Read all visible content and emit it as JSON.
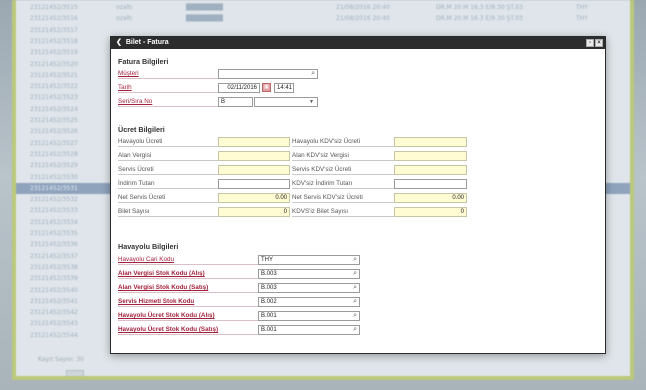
{
  "background": {
    "rows": [
      {
        "id": "23121452/3515",
        "c2": "ozaltı",
        "c3": "████████",
        "c4": "21/08/2016 20:40",
        "c5": "DR.M    20.M   16.3  E/9.30 ŞT.03",
        "c6": "THY"
      },
      {
        "id": "23121452/3516",
        "c2": "ozaltı",
        "c3": "████████",
        "c4": "21/08/2016 20:40",
        "c5": "DR.M    20.M   16.3  E/9.30 ŞT.03",
        "c6": "THY"
      },
      {
        "id": "23121452/3517",
        "c2": "",
        "c3": "",
        "c4": "",
        "c5": "",
        "c6": ""
      },
      {
        "id": "23121452/3518",
        "c2": "",
        "c3": "",
        "c4": "",
        "c5": "",
        "c6": ""
      },
      {
        "id": "23121452/3519",
        "c2": "",
        "c3": "",
        "c4": "",
        "c5": "",
        "c6": ""
      },
      {
        "id": "23121452/3520",
        "c2": "",
        "c3": "",
        "c4": "",
        "c5": "",
        "c6": ""
      },
      {
        "id": "23121452/3521",
        "c2": "",
        "c3": "",
        "c4": "",
        "c5": "",
        "c6": ""
      },
      {
        "id": "23121452/3522",
        "c2": "",
        "c3": "",
        "c4": "",
        "c5": "",
        "c6": ""
      },
      {
        "id": "23121452/3523",
        "c2": "",
        "c3": "",
        "c4": "",
        "c5": "",
        "c6": ""
      },
      {
        "id": "23121452/3524",
        "c2": "",
        "c3": "",
        "c4": "",
        "c5": "",
        "c6": ""
      },
      {
        "id": "23121452/3525",
        "c2": "",
        "c3": "",
        "c4": "",
        "c5": "",
        "c6": ""
      },
      {
        "id": "23121452/3526",
        "c2": "",
        "c3": "",
        "c4": "",
        "c5": "",
        "c6": ""
      },
      {
        "id": "23121452/3527",
        "c2": "",
        "c3": "",
        "c4": "",
        "c5": "",
        "c6": ""
      },
      {
        "id": "23121452/3528",
        "c2": "",
        "c3": "",
        "c4": "",
        "c5": "",
        "c6": ""
      },
      {
        "id": "23121452/3529",
        "c2": "",
        "c3": "",
        "c4": "",
        "c5": "",
        "c6": ""
      },
      {
        "id": "23121452/3530",
        "c2": "",
        "c3": "",
        "c4": "",
        "c5": "",
        "c6": ""
      },
      {
        "id": "23121452/3531",
        "c2": "",
        "c3": "",
        "c4": "",
        "c5": "",
        "c6": ""
      },
      {
        "id": "23121452/3532",
        "c2": "",
        "c3": "",
        "c4": "",
        "c5": "",
        "c6": ""
      },
      {
        "id": "23121452/3533",
        "c2": "",
        "c3": "",
        "c4": "",
        "c5": "",
        "c6": ""
      },
      {
        "id": "23121452/3534",
        "c2": "",
        "c3": "",
        "c4": "",
        "c5": "",
        "c6": ""
      },
      {
        "id": "23121452/3535",
        "c2": "",
        "c3": "",
        "c4": "",
        "c5": "",
        "c6": ""
      },
      {
        "id": "23121452/3536",
        "c2": "",
        "c3": "",
        "c4": "",
        "c5": "",
        "c6": ""
      },
      {
        "id": "23121452/3537",
        "c2": "",
        "c3": "",
        "c4": "",
        "c5": "",
        "c6": ""
      },
      {
        "id": "23121452/3538",
        "c2": "",
        "c3": "",
        "c4": "",
        "c5": "",
        "c6": ""
      },
      {
        "id": "23121452/3539",
        "c2": "",
        "c3": "",
        "c4": "",
        "c5": "",
        "c6": ""
      },
      {
        "id": "23121452/3540",
        "c2": "",
        "c3": "",
        "c4": "",
        "c5": "",
        "c6": ""
      },
      {
        "id": "23121452/3541",
        "c2": "",
        "c3": "",
        "c4": "",
        "c5": "",
        "c6": ""
      },
      {
        "id": "23121452/3542",
        "c2": "",
        "c3": "",
        "c4": "",
        "c5": "",
        "c6": ""
      },
      {
        "id": "23121452/3543",
        "c2": "",
        "c3": "",
        "c4": "",
        "c5": "",
        "c6": ""
      },
      {
        "id": "23121452/3544",
        "c2": "",
        "c3": "",
        "c4": "",
        "c5": "",
        "c6": ""
      }
    ],
    "selected_index": 16,
    "footer_text": "Kayıt Sayısı: 30"
  },
  "dialog": {
    "back_icon": "chevron-left-icon",
    "title": "Bilet - Fatura",
    "controls": [
      "restore-icon",
      "close-icon"
    ],
    "fatura": {
      "heading": "Fatura Bilgileri",
      "musteri_label": "Müşteri",
      "musteri_value": "",
      "tarih_label": "Tarih",
      "tarih_date": "02/11/2016",
      "tarih_time": "14:41",
      "seri_label": "Seri/Sıra No",
      "seri_value": "B",
      "sira_value": ""
    },
    "ucret": {
      "heading": "Ücret Bilgileri",
      "left": [
        {
          "label": "Havayolu Ücreti",
          "value": ""
        },
        {
          "label": "Alan Vergisi",
          "value": ""
        },
        {
          "label": "Servis Ücreti",
          "value": ""
        },
        {
          "label": "İndirim Tutarı",
          "value": ""
        },
        {
          "label": "Net Servis Ücreti",
          "value": "0.00"
        },
        {
          "label": "Bilet Sayısı",
          "value": "0"
        }
      ],
      "right": [
        {
          "label": "Havayolu KDV'siz Ücreti",
          "value": ""
        },
        {
          "label": "Alan KDV'siz Vergisi",
          "value": ""
        },
        {
          "label": "Servis KDV'siz Ücreti",
          "value": ""
        },
        {
          "label": "KDV'siz İndirim Tutarı",
          "value": ""
        },
        {
          "label": "Net Servis KDV'siz Ücreti",
          "value": "0.00"
        },
        {
          "label": "KDVS'iz Bilet Sayısı",
          "value": "0"
        }
      ]
    },
    "havayolu": {
      "heading": "Havayolu Bilgileri",
      "rows": [
        {
          "label": "Havayolu Cari Kodu",
          "value": "THY"
        },
        {
          "label": "Alan Vergisi Stok Kodu (Alış)",
          "value": "B.003"
        },
        {
          "label": "Alan Vergisi Stok Kodu (Satış)",
          "value": "B.003"
        },
        {
          "label": "Servis Hizmeti Stok Kodu",
          "value": "B.002"
        },
        {
          "label": "Havayolu Ücret Stok Kodu (Alış)",
          "value": "B.001"
        },
        {
          "label": "Havayolu Ücret Stok Kodu (Satış)",
          "value": "B.001"
        }
      ]
    }
  }
}
